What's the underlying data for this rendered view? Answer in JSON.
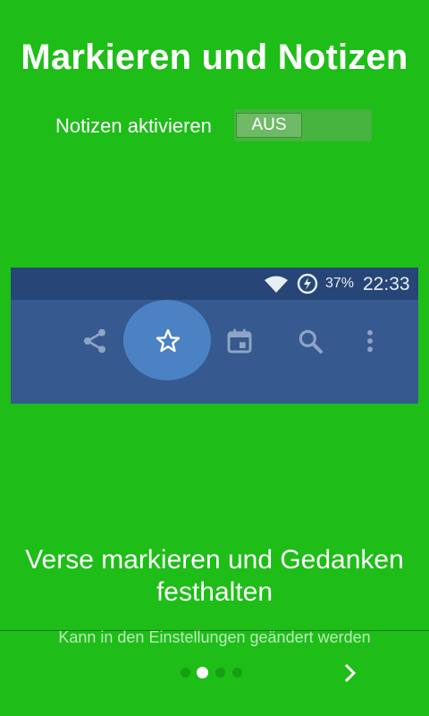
{
  "title": "Markieren und Notizen",
  "toggle": {
    "label": "Notizen aktivieren",
    "state": "AUS"
  },
  "preview": {
    "status": {
      "battery_pct": "37%",
      "time": "22:33"
    },
    "toolbar_icons": [
      "share-icon",
      "star-icon",
      "calendar-icon",
      "search-icon",
      "more-vert-icon"
    ]
  },
  "headline": "Verse markieren und Gedanken festhalten",
  "hint": "Kann in den Einstellungen geändert werden",
  "pager": {
    "pages": 4,
    "current": 2
  },
  "colors": {
    "background": "#1ebd18",
    "preview_bar": "#36598f",
    "highlight": "#4a82c4"
  }
}
